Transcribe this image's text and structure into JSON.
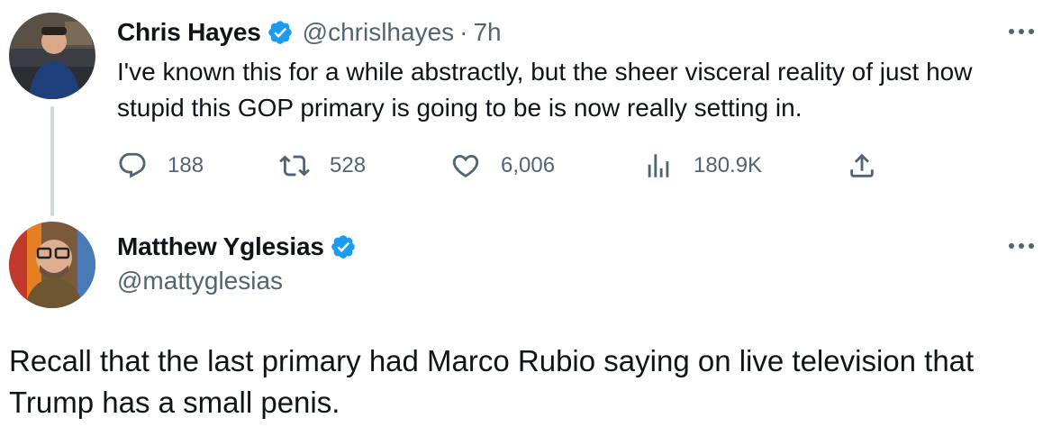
{
  "colors": {
    "text": "#0f1419",
    "secondary": "#536471",
    "verified": "#1d9bf0",
    "thread_line": "#cfd9de"
  },
  "quoted_tweet": {
    "author_name": "Chris Hayes",
    "handle": "@chrislhayes",
    "separator": "·",
    "time": "7h",
    "verified_icon": "verified-badge-icon",
    "text": "I've known this for a while abstractly, but the sheer visceral reality of just how stupid this GOP primary is going to be is now really setting in.",
    "actions": {
      "replies": "188",
      "retweets": "528",
      "likes": "6,006",
      "views": "180.9K"
    }
  },
  "reply_tweet": {
    "author_name": "Matthew Yglesias",
    "handle": "@mattyglesias",
    "verified_icon": "verified-badge-icon",
    "text": "Recall that the last primary had Marco Rubio saying on live television that Trump has a small penis."
  }
}
